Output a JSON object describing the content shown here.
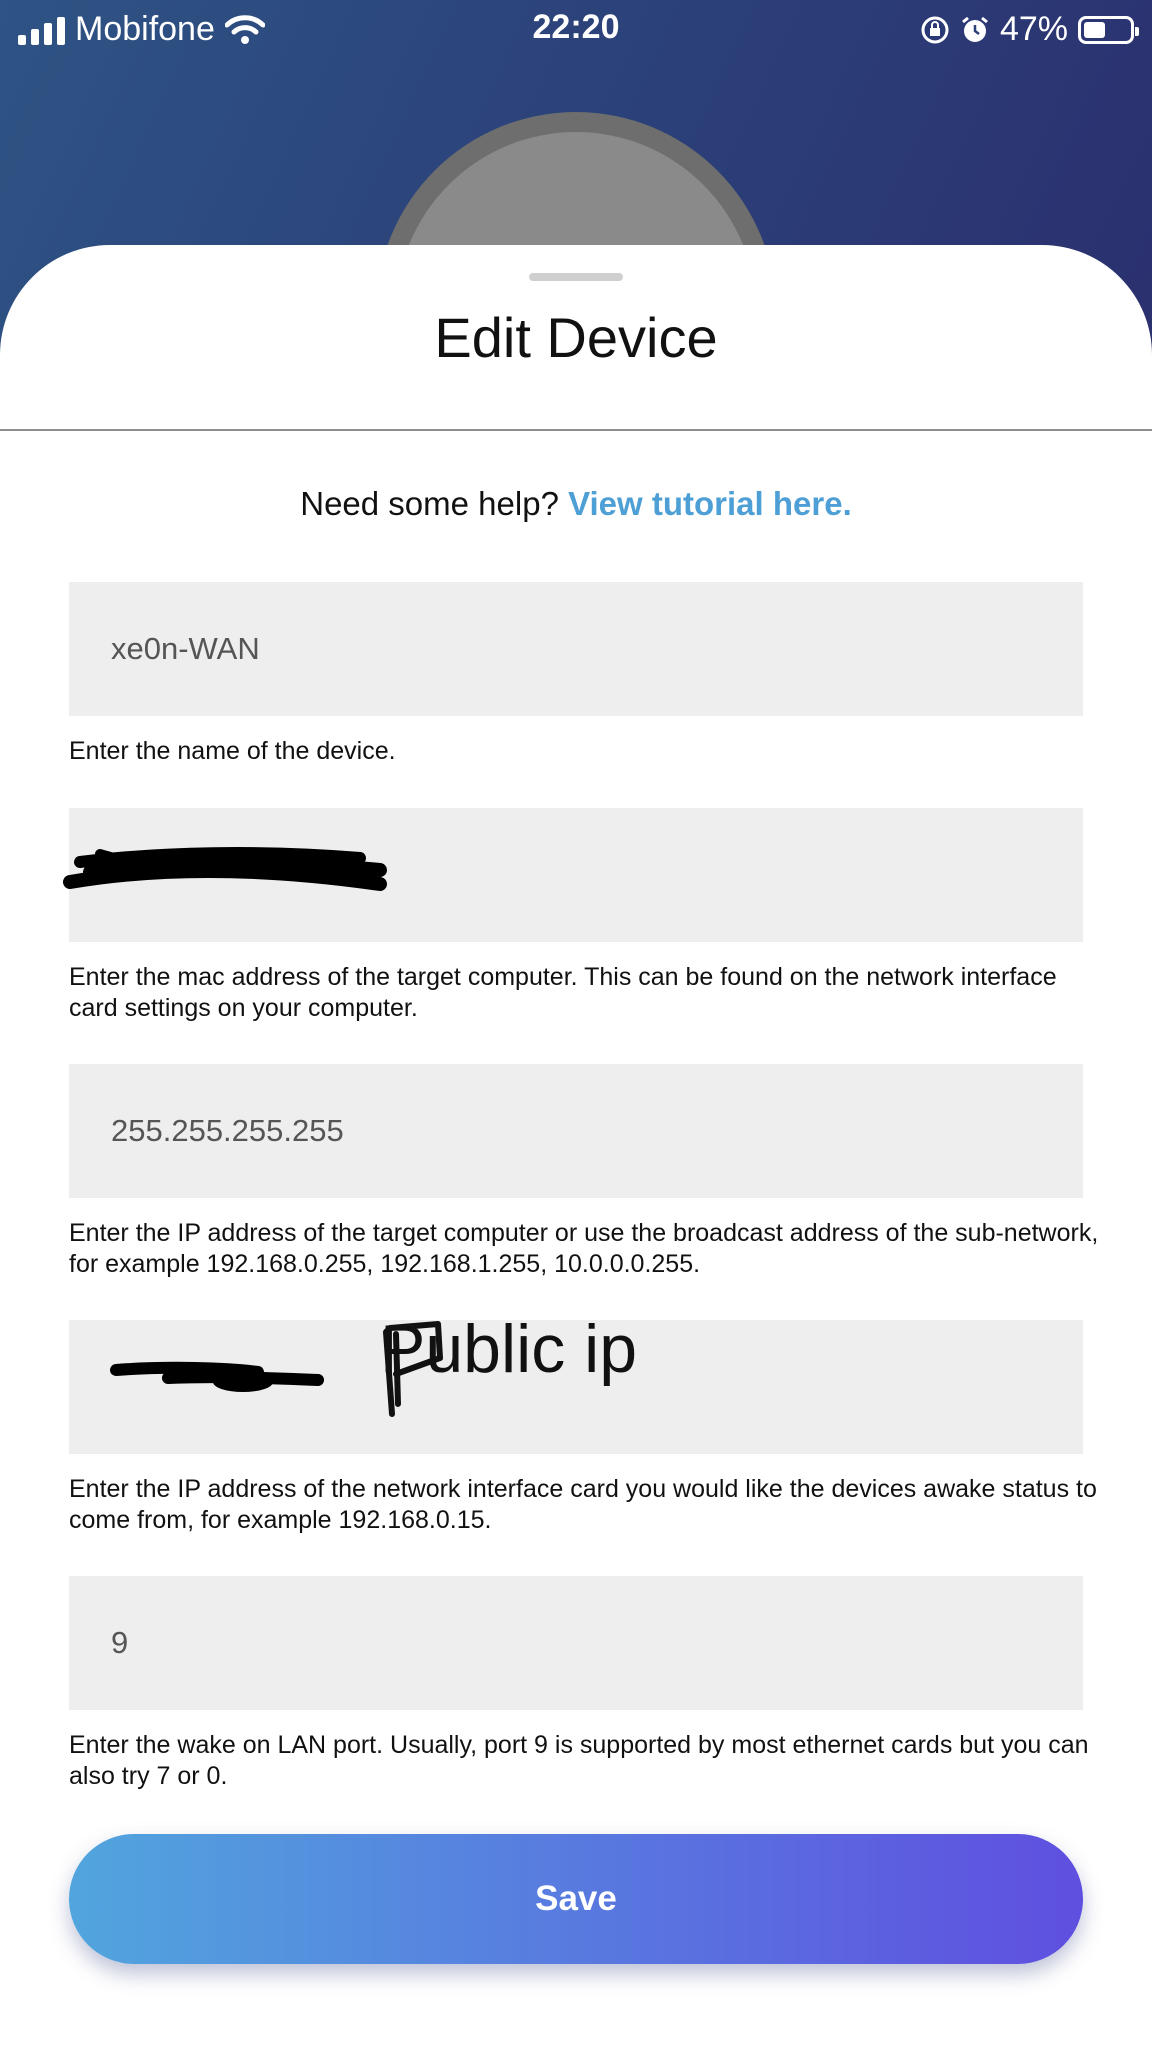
{
  "status_bar": {
    "carrier": "Mobifone",
    "time": "22:20",
    "battery_percent": "47%",
    "battery_level": 0.47
  },
  "sheet": {
    "title": "Edit Device"
  },
  "help": {
    "prefix": "Need some help?",
    "link": "View tutorial here."
  },
  "fields": {
    "name": {
      "value": "xe0n-WAN",
      "hint": "Enter the name of the device."
    },
    "mac": {
      "value": "",
      "hint": "Enter the mac address of the target computer. This can be found on the network interface card settings on your computer."
    },
    "ip": {
      "value": "255.255.255.255",
      "hint": "Enter the IP address of the target computer or use the broadcast address of the sub-network, for example 192.168.0.255, 192.168.1.255, 10.0.0.0.255."
    },
    "nic_ip": {
      "value": "",
      "annotation": "Public ip",
      "hint": "Enter the IP address of the network interface card you would like the devices awake status to come from, for example 192.168.0.15."
    },
    "port": {
      "value": "9",
      "hint": "Enter the wake on LAN port. Usually, port 9 is supported by most ethernet cards but you can also try 7 or 0."
    }
  },
  "actions": {
    "save_label": "Save"
  },
  "icons": {
    "signal": "cellular-signal-icon",
    "wifi": "wifi-icon",
    "rotation_lock": "rotation-lock-icon",
    "alarm": "alarm-icon",
    "battery": "battery-icon"
  },
  "colors": {
    "header_gradient_start": "#2e5384",
    "header_gradient_end": "#2b2f6e",
    "link": "#4d9fd5",
    "field_background": "#eeeeee",
    "save_gradient_start": "#51a5de",
    "save_gradient_end": "#5f4fe0"
  }
}
